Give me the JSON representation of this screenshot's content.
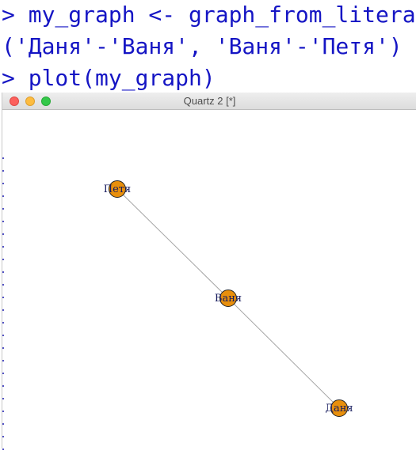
{
  "console": {
    "line1": "> my_graph <- graph_from_literal",
    "line2": "('Даня'-'Ваня', 'Ваня'-'Петя')",
    "line3": "> plot(my_graph)",
    "text_color": "#1515c4"
  },
  "window": {
    "title": "Quartz 2 [*]"
  },
  "graph": {
    "node_color": "#e88f0c",
    "edge_color": "#a5a5a5",
    "nodes": [
      {
        "id": "Петя",
        "label": "Петя"
      },
      {
        "id": "Ваня",
        "label": "Ваня"
      },
      {
        "id": "Даня",
        "label": "Даня"
      }
    ],
    "edges": [
      {
        "from": "Даня",
        "to": "Ваня"
      },
      {
        "from": "Ваня",
        "to": "Петя"
      }
    ]
  }
}
